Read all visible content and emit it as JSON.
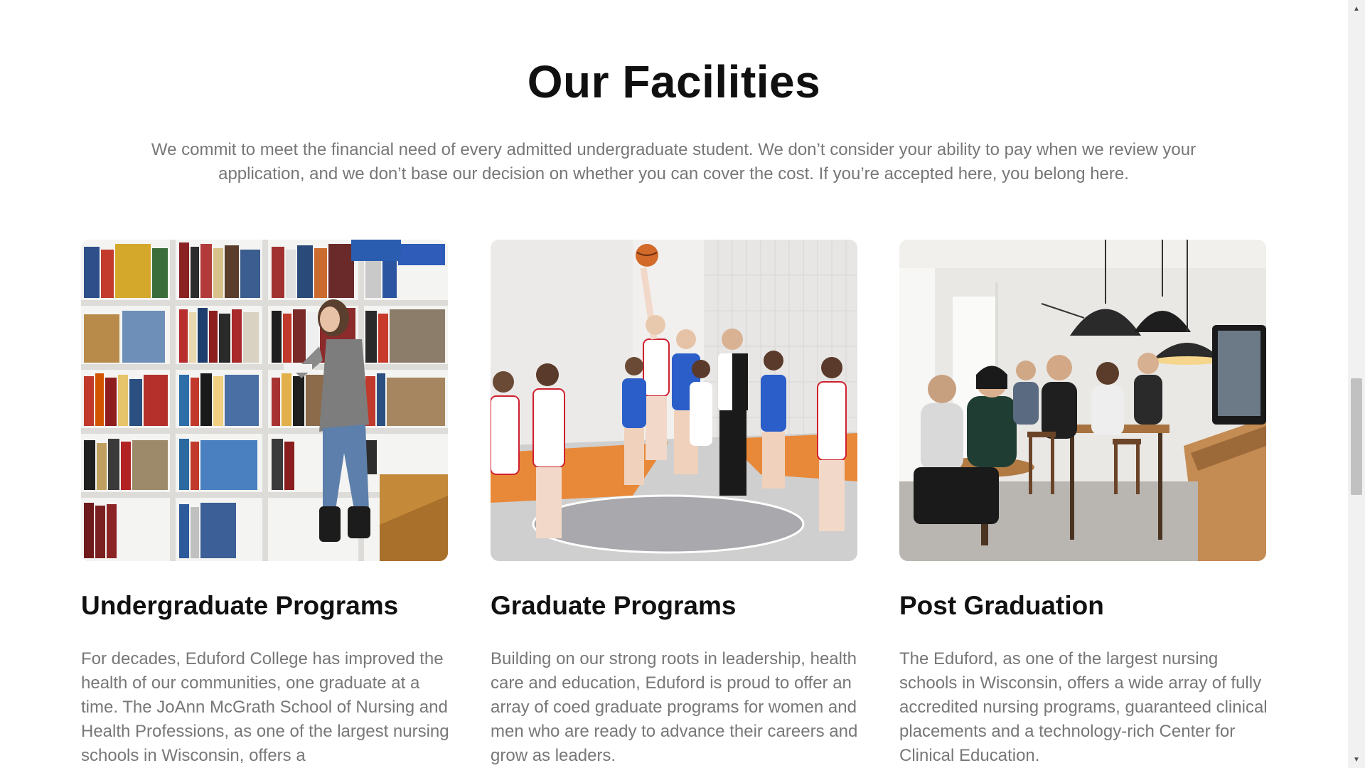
{
  "section": {
    "title": "Our Facilities",
    "intro": "We commit to meet the financial need of every admitted undergraduate student. We don’t consider your ability to pay when we review your application, and we don’t base our decision on whether you can cover the cost. If you’re accepted here, you belong here."
  },
  "cards": [
    {
      "image": "library-photo",
      "title": "Undergraduate Programs",
      "text": "For decades, Eduford College has improved the health of our communities, one graduate at a time. The JoAnn McGrath School of Nursing and Health Professions, as one of the largest nursing schools in Wisconsin, offers a"
    },
    {
      "image": "basketball-photo",
      "title": "Graduate Programs",
      "text": "Building on our strong roots in leadership, health care and education, Eduford is proud to offer an array of coed graduate programs for women and men who are ready to advance their careers and grow as leaders."
    },
    {
      "image": "cafe-photo",
      "title": "Post Graduation",
      "text": "The Eduford, as one of the largest nursing schools in Wisconsin, offers a wide array of fully accredited nursing programs, guaranteed clinical placements and a technology-rich Center for Clinical Education."
    }
  ],
  "scrollbar": {
    "up_icon": "scroll-up-arrow-icon",
    "down_icon": "scroll-down-arrow-icon"
  },
  "colors": {
    "title": "#101010",
    "body_text": "#777777",
    "background": "#ffffff"
  }
}
